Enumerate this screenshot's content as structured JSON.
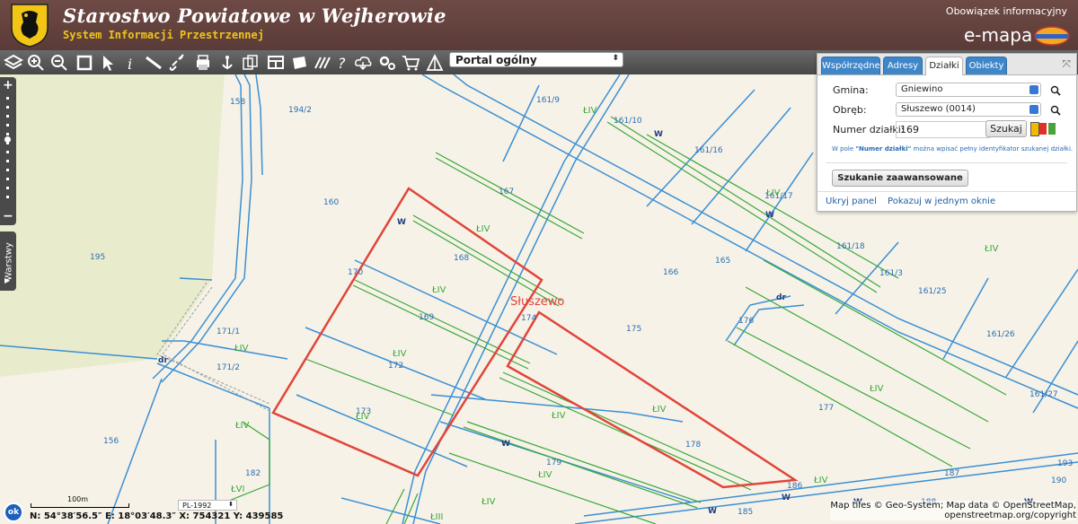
{
  "header": {
    "title": "Starostwo Powiatowe w Wejherowie",
    "subtitle": "System Informacji Przestrzennej",
    "obowiazek": "Obowiązek informacyjny",
    "brand": "e-mapa"
  },
  "toolbar": {
    "portal_select": "Portal ogólny"
  },
  "panel": {
    "tabs": [
      "Współrzędne",
      "Adresy",
      "Działki",
      "Obiekty"
    ],
    "active_tab": "Działki",
    "gmina_label": "Gmina:",
    "gmina_value": "Gniewino",
    "obreb_label": "Obręb:",
    "obreb_value": "Słuszewo (0014)",
    "numer_label": "Numer działki:",
    "numer_value": "169",
    "szukaj_label": "Szukaj",
    "hint_prefix": "W pole ",
    "hint_bold": "\"Numer działki\"",
    "hint_suffix": " można wpisać pełny identyfikator szukanej działki.",
    "advanced_label": "Szukanie zaawansowane",
    "hide_panel": "Ukryj panel",
    "show_one_window": "Pokazuj w jednym oknie"
  },
  "side": {
    "layers_label": "Warstwy"
  },
  "map": {
    "place_name": "Słuszewo",
    "parcel_labels": [
      "158",
      "194/2",
      "161/9",
      "161/10",
      "161/16",
      "161/17",
      "161/18",
      "161/3",
      "161/25",
      "161/26",
      "161/27",
      "160",
      "167",
      "168",
      "170",
      "166",
      "165",
      "195",
      "171/1",
      "171/2",
      "173",
      "172",
      "169",
      "174",
      "175",
      "176",
      "177",
      "178",
      "179",
      "182",
      "156",
      "186",
      "187",
      "190",
      "193",
      "185",
      "188"
    ],
    "landuse_labels": [
      "ŁIV",
      "ŁIV",
      "ŁIV",
      "ŁIV",
      "ŁIV",
      "ŁIV",
      "ŁIV",
      "ŁIV",
      "ŁIV",
      "ŁIV",
      "ŁIV",
      "ŁIV",
      "ŁIV",
      "ŁIV",
      "ŁIV",
      "ŁVI",
      "ŁIII"
    ],
    "ditch_labels": [
      "W",
      "W",
      "W",
      "W",
      "W",
      "W",
      "W",
      "W",
      "dr",
      "dr"
    ]
  },
  "status": {
    "ok": "ok",
    "scale": "100m",
    "crs": "PL-1992",
    "coords": "N: 54°38′56.5″  E: 18°03′48.3″   X: 754321     Y: 439585",
    "attribution_1": "Map tiles © Geo-System; Map data © OpenStreetMap,",
    "attribution_2": "openstreetmap.org/copyright"
  },
  "colors": {
    "header_bg": "#5a3b38",
    "accent_yellow": "#f0c419",
    "parcel_line": "#3b8fd4",
    "landuse_green": "#3aa83a",
    "selection_red": "#e0453a",
    "meadow": "#e9eccc"
  }
}
